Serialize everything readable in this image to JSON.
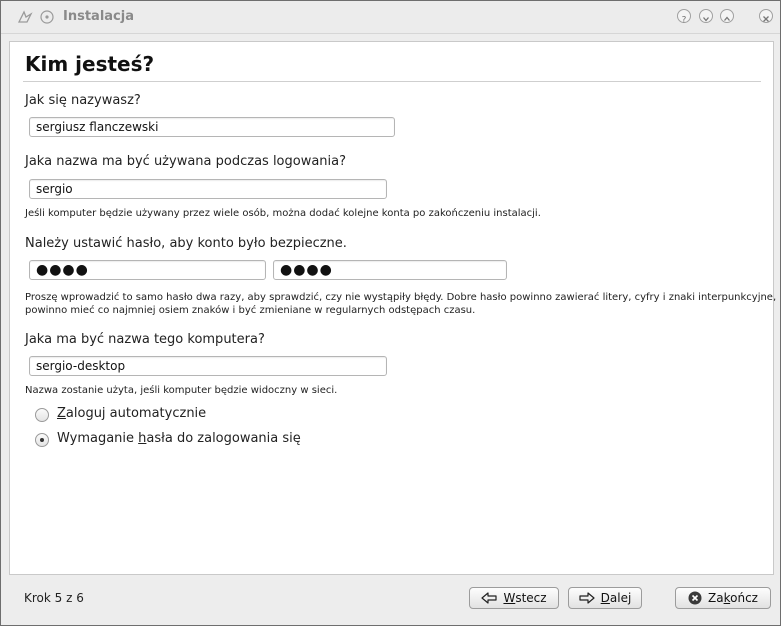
{
  "window": {
    "title": "Instalacja",
    "app_icon": "installer-icon",
    "titlebar_buttons": [
      "help-icon",
      "minimize-icon",
      "maximize-icon",
      "close-icon"
    ]
  },
  "page": {
    "heading": "Kim jesteś?"
  },
  "form": {
    "name_label": "Jak się nazywasz?",
    "name_value": "sergiusz flanczewski",
    "login_label": "Jaka nazwa ma być używana podczas logowania?",
    "login_value": "sergio",
    "login_hint": "Jeśli komputer będzie używany przez wiele osób, można dodać kolejne konta po zakończeniu instalacji.",
    "password_label": "Należy ustawić hasło, aby konto było bezpieczne.",
    "password_value": "●●●●",
    "password_confirm_value": "●●●●",
    "password_hint_line1": "Proszę wprowadzić to samo hasło dwa razy, aby sprawdzić, czy nie wystąpiły błędy. Dobre hasło powinno zawierać litery, cyfry i znaki interpunkcyjne,",
    "password_hint_line2": "powinno mieć co najmniej osiem znaków i być zmieniane w regularnych odstępach czasu.",
    "hostname_label": "Jaka ma być nazwa tego komputera?",
    "hostname_value": "sergio-desktop",
    "hostname_hint": "Nazwa zostanie użyta, jeśli komputer będzie widoczny w sieci.",
    "radio_autologin_label": "Zaloguj automatycznie",
    "radio_password_label": "Wymaganie hasła do zalogowania się",
    "selected_option": "Wymaganie hasła do zalogowania się"
  },
  "footer": {
    "step_text": "Krok 5 z 6",
    "back_label": "Wstecz",
    "next_label": "Dalej",
    "quit_label": "Zakończ"
  }
}
